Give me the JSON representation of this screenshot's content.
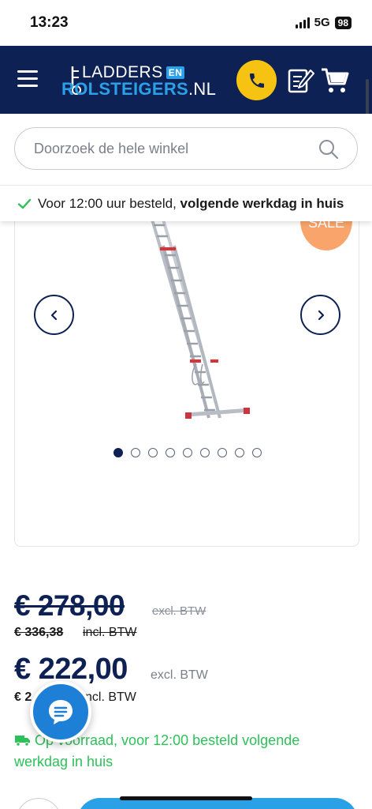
{
  "status_bar": {
    "time": "13:23",
    "network": "5G",
    "battery": "98"
  },
  "header": {
    "logo": {
      "line1": "LADDERS",
      "en": "EN",
      "line2": "ROLSTEIGERS",
      "tld": ".NL"
    },
    "icons": [
      "menu-icon",
      "phone-icon",
      "quote-icon",
      "cart-icon"
    ],
    "colors": {
      "navy": "#0e2154",
      "yellow": "#f7c312",
      "blue": "#2aa0e6"
    }
  },
  "search": {
    "placeholder": "Doorzoek de hele winkel"
  },
  "usp": {
    "text_regular": "Voor 12:00 uur besteld, ",
    "text_bold": "volgende werkdag in huis"
  },
  "gallery": {
    "badge": "SALE",
    "slide_count": 9,
    "active_slide": 1
  },
  "pricing": {
    "old_price_excl": "€ 278,00",
    "old_label_excl": "excl. BTW",
    "old_price_incl": "€ 336,38",
    "old_label_incl": "incl. BTW",
    "new_price_excl": "€ 222,00",
    "new_label_excl": "excl. BTW",
    "new_price_incl": "€ 2",
    "new_label_incl": "ncl. BTW"
  },
  "stock": {
    "text": "Op voorraad, voor 12:00 besteld volgende werkdag in huis"
  }
}
